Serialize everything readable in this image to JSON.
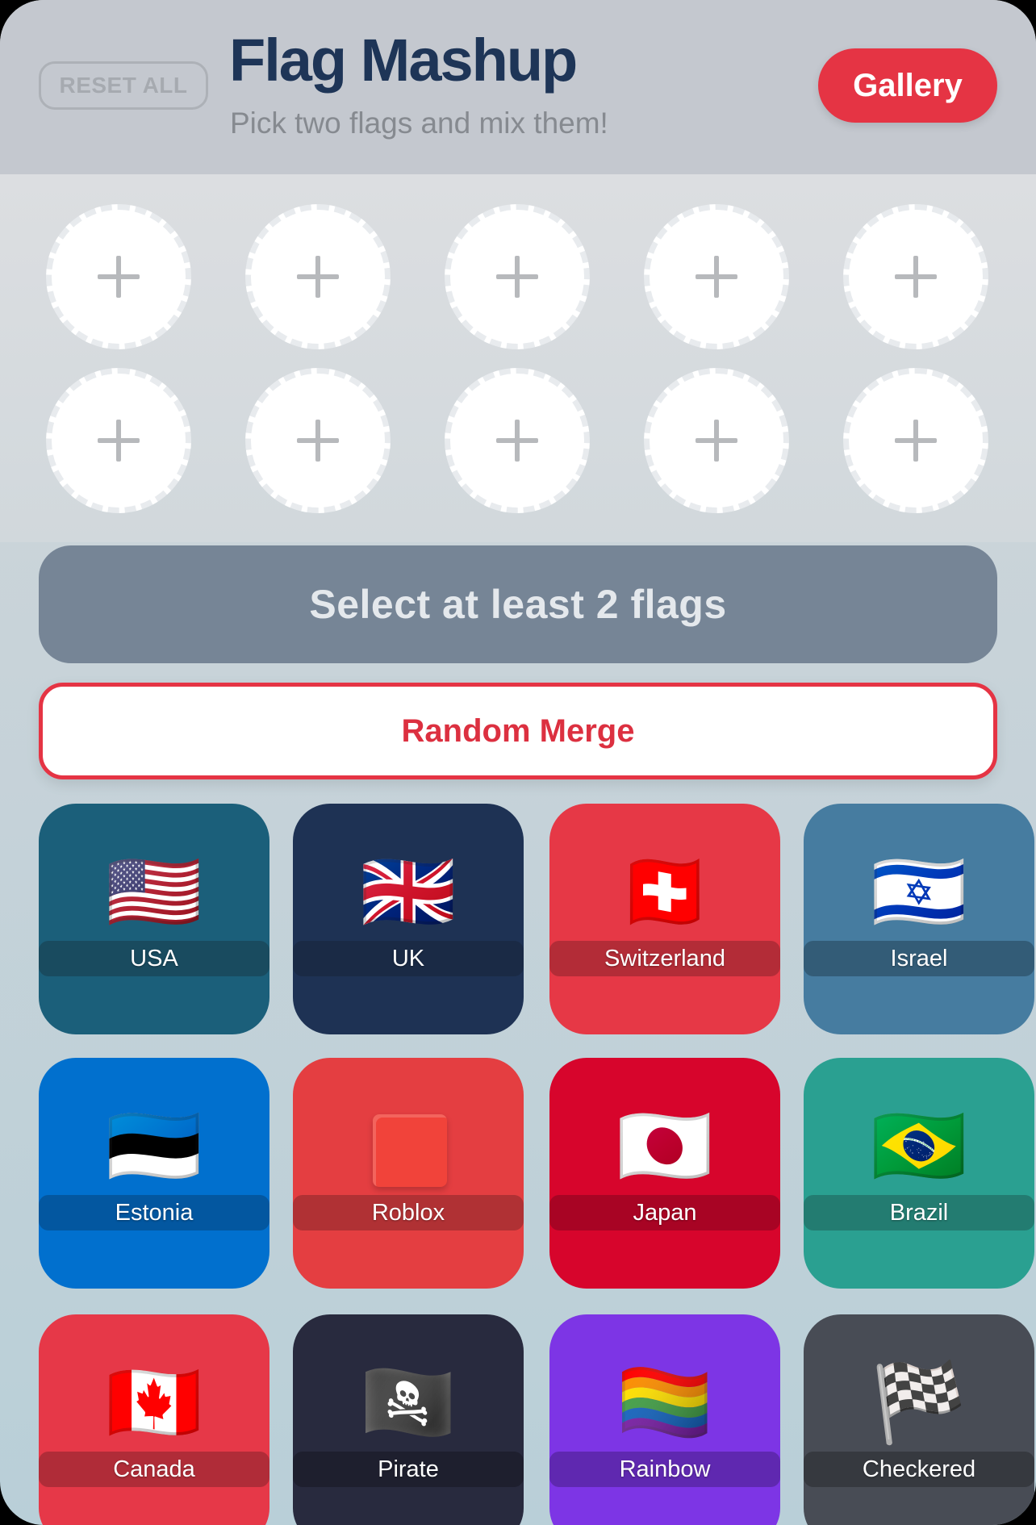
{
  "header": {
    "reset_label": "RESET ALL",
    "title": "Flag Mashup",
    "subtitle": "Pick two flags and mix them!",
    "gallery_label": "Gallery"
  },
  "slots": {
    "count": 10,
    "plus_symbol": "+"
  },
  "actions": {
    "select_prompt": "Select at least 2 flags",
    "random_merge_label": "Random Merge"
  },
  "flags": [
    {
      "name": "USA",
      "emoji": "🇺🇸",
      "color": "#1b5f7a",
      "label_bg": "#194b5f"
    },
    {
      "name": "UK",
      "emoji": "🇬🇧",
      "color": "#1e3254",
      "label_bg": "#1a2a45"
    },
    {
      "name": "Switzerland",
      "emoji": "🇨🇭",
      "color": "#e63846",
      "label_bg": "#b32c37"
    },
    {
      "name": "Israel",
      "emoji": "🇮🇱",
      "color": "#467ca0",
      "label_bg": "#335c77"
    },
    {
      "name": "Estonia",
      "emoji": "🇪🇪",
      "color": "#0170ce",
      "label_bg": "#0357a0"
    },
    {
      "name": "Roblox",
      "emoji": "",
      "color": "#e43e41",
      "label_bg": "#b03134"
    },
    {
      "name": "Japan",
      "emoji": "🇯🇵",
      "color": "#d7052c",
      "label_bg": "#a80424"
    },
    {
      "name": "Brazil",
      "emoji": "🇧🇷",
      "color": "#2aa091",
      "label_bg": "#237c71"
    },
    {
      "name": "Canada",
      "emoji": "🇨🇦",
      "color": "#e63848",
      "label_bg": "#b02c38"
    },
    {
      "name": "Pirate",
      "emoji": "🏴‍☠️",
      "color": "#282a3e",
      "label_bg": "#1e1f2e"
    },
    {
      "name": "Rainbow",
      "emoji": "🏳️‍🌈",
      "color": "#7d35e5",
      "label_bg": "#5f28b0"
    },
    {
      "name": "Checkered",
      "emoji": "🏁",
      "color": "#484c55",
      "label_bg": "#36393f"
    }
  ]
}
